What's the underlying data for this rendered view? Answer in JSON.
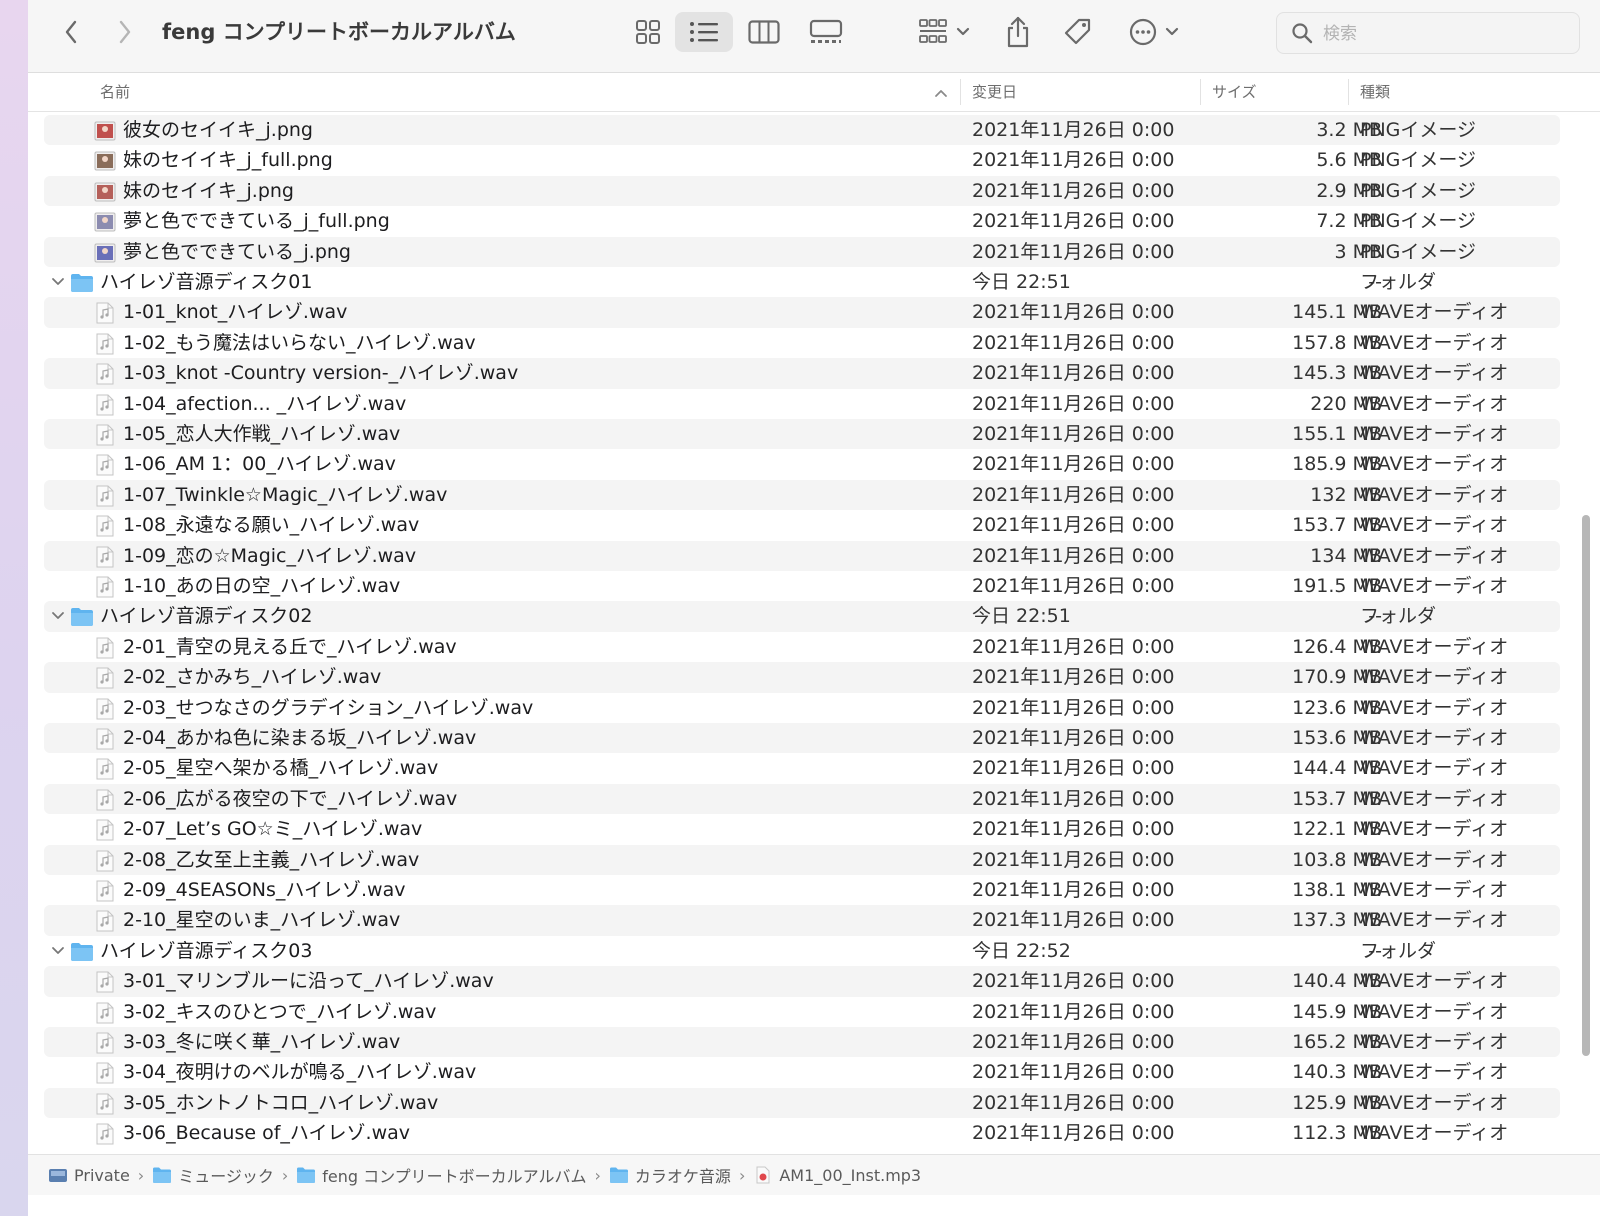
{
  "window": {
    "title": "feng コンプリートボーカルアルバム"
  },
  "toolbar": {
    "back_icon": "chevron-left-icon",
    "forward_icon": "chevron-right-icon",
    "view_modes": [
      "icon-view",
      "list-view",
      "column-view",
      "gallery-view"
    ],
    "active_view": "list-view",
    "search_placeholder": "検索"
  },
  "columns": {
    "name": "名前",
    "date": "変更日",
    "size": "サイズ",
    "kind": "種類"
  },
  "rows": [
    {
      "name": "彼女のセイイキ_j.png",
      "date": "2021年11月26日 0:00",
      "size": "3.2 MB",
      "kind": "PNGイメージ",
      "type": "image",
      "thumb": "#c0504d"
    },
    {
      "name": "妹のセイイキ_j_full.png",
      "date": "2021年11月26日 0:00",
      "size": "5.6 MB",
      "kind": "PNGイメージ",
      "type": "image",
      "thumb": "#8a6d5a"
    },
    {
      "name": "妹のセイイキ_j.png",
      "date": "2021年11月26日 0:00",
      "size": "2.9 MB",
      "kind": "PNGイメージ",
      "type": "image",
      "thumb": "#b5605a"
    },
    {
      "name": "夢と色でできている_j_full.png",
      "date": "2021年11月26日 0:00",
      "size": "7.2 MB",
      "kind": "PNGイメージ",
      "type": "image",
      "thumb": "#8c8cb0"
    },
    {
      "name": "夢と色でできている_j.png",
      "date": "2021年11月26日 0:00",
      "size": "3 MB",
      "kind": "PNGイメージ",
      "type": "image",
      "thumb": "#6a6fb8"
    },
    {
      "name": "ハイレゾ音源ディスク01",
      "date": "今日 22:51",
      "size": "--",
      "kind": "フォルダ",
      "type": "folder"
    },
    {
      "name": "1-01_knot_ハイレゾ.wav",
      "date": "2021年11月26日 0:00",
      "size": "145.1 MB",
      "kind": "WAVEオーディオ",
      "type": "audio"
    },
    {
      "name": "1-02_もう魔法はいらない_ハイレゾ.wav",
      "date": "2021年11月26日 0:00",
      "size": "157.8 MB",
      "kind": "WAVEオーディオ",
      "type": "audio"
    },
    {
      "name": "1-03_knot -Country version-_ハイレゾ.wav",
      "date": "2021年11月26日 0:00",
      "size": "145.3 MB",
      "kind": "WAVEオーディオ",
      "type": "audio"
    },
    {
      "name": "1-04_afection... _ハイレゾ.wav",
      "date": "2021年11月26日 0:00",
      "size": "220 MB",
      "kind": "WAVEオーディオ",
      "type": "audio"
    },
    {
      "name": "1-05_恋人大作戦_ハイレゾ.wav",
      "date": "2021年11月26日 0:00",
      "size": "155.1 MB",
      "kind": "WAVEオーディオ",
      "type": "audio"
    },
    {
      "name": "1-06_AM 1：00_ハイレゾ.wav",
      "date": "2021年11月26日 0:00",
      "size": "185.9 MB",
      "kind": "WAVEオーディオ",
      "type": "audio"
    },
    {
      "name": "1-07_Twinkle☆Magic_ハイレゾ.wav",
      "date": "2021年11月26日 0:00",
      "size": "132 MB",
      "kind": "WAVEオーディオ",
      "type": "audio"
    },
    {
      "name": "1-08_永遠なる願い_ハイレゾ.wav",
      "date": "2021年11月26日 0:00",
      "size": "153.7 MB",
      "kind": "WAVEオーディオ",
      "type": "audio"
    },
    {
      "name": "1-09_恋の☆Magic_ハイレゾ.wav",
      "date": "2021年11月26日 0:00",
      "size": "134 MB",
      "kind": "WAVEオーディオ",
      "type": "audio"
    },
    {
      "name": "1-10_あの日の空_ハイレゾ.wav",
      "date": "2021年11月26日 0:00",
      "size": "191.5 MB",
      "kind": "WAVEオーディオ",
      "type": "audio"
    },
    {
      "name": "ハイレゾ音源ディスク02",
      "date": "今日 22:51",
      "size": "--",
      "kind": "フォルダ",
      "type": "folder"
    },
    {
      "name": "2-01_青空の見える丘で_ハイレゾ.wav",
      "date": "2021年11月26日 0:00",
      "size": "126.4 MB",
      "kind": "WAVEオーディオ",
      "type": "audio"
    },
    {
      "name": "2-02_さかみち_ハイレゾ.wav",
      "date": "2021年11月26日 0:00",
      "size": "170.9 MB",
      "kind": "WAVEオーディオ",
      "type": "audio"
    },
    {
      "name": "2-03_せつなさのグラデイション_ハイレゾ.wav",
      "date": "2021年11月26日 0:00",
      "size": "123.6 MB",
      "kind": "WAVEオーディオ",
      "type": "audio"
    },
    {
      "name": "2-04_あかね色に染まる坂_ハイレゾ.wav",
      "date": "2021年11月26日 0:00",
      "size": "153.6 MB",
      "kind": "WAVEオーディオ",
      "type": "audio"
    },
    {
      "name": "2-05_星空へ架かる橋_ハイレゾ.wav",
      "date": "2021年11月26日 0:00",
      "size": "144.4 MB",
      "kind": "WAVEオーディオ",
      "type": "audio"
    },
    {
      "name": "2-06_広がる夜空の下で_ハイレゾ.wav",
      "date": "2021年11月26日 0:00",
      "size": "153.7 MB",
      "kind": "WAVEオーディオ",
      "type": "audio"
    },
    {
      "name": "2-07_Let’s GO☆ミ_ハイレゾ.wav",
      "date": "2021年11月26日 0:00",
      "size": "122.1 MB",
      "kind": "WAVEオーディオ",
      "type": "audio"
    },
    {
      "name": "2-08_乙女至上主義_ハイレゾ.wav",
      "date": "2021年11月26日 0:00",
      "size": "103.8 MB",
      "kind": "WAVEオーディオ",
      "type": "audio"
    },
    {
      "name": "2-09_4SEASONs_ハイレゾ.wav",
      "date": "2021年11月26日 0:00",
      "size": "138.1 MB",
      "kind": "WAVEオーディオ",
      "type": "audio"
    },
    {
      "name": "2-10_星空のいま_ハイレゾ.wav",
      "date": "2021年11月26日 0:00",
      "size": "137.3 MB",
      "kind": "WAVEオーディオ",
      "type": "audio"
    },
    {
      "name": "ハイレゾ音源ディスク03",
      "date": "今日 22:52",
      "size": "--",
      "kind": "フォルダ",
      "type": "folder"
    },
    {
      "name": "3-01_マリンブルーに沿って_ハイレゾ.wav",
      "date": "2021年11月26日 0:00",
      "size": "140.4 MB",
      "kind": "WAVEオーディオ",
      "type": "audio"
    },
    {
      "name": "3-02_キスのひとつで_ハイレゾ.wav",
      "date": "2021年11月26日 0:00",
      "size": "145.9 MB",
      "kind": "WAVEオーディオ",
      "type": "audio"
    },
    {
      "name": "3-03_冬に咲く華_ハイレゾ.wav",
      "date": "2021年11月26日 0:00",
      "size": "165.2 MB",
      "kind": "WAVEオーディオ",
      "type": "audio"
    },
    {
      "name": "3-04_夜明けのベルが鳴る_ハイレゾ.wav",
      "date": "2021年11月26日 0:00",
      "size": "140.3 MB",
      "kind": "WAVEオーディオ",
      "type": "audio"
    },
    {
      "name": "3-05_ホントノトコロ_ハイレゾ.wav",
      "date": "2021年11月26日 0:00",
      "size": "125.9 MB",
      "kind": "WAVEオーディオ",
      "type": "audio"
    },
    {
      "name": "3-06_Because of_ハイレゾ.wav",
      "date": "2021年11月26日 0:00",
      "size": "112.3 MB",
      "kind": "WAVEオーディオ",
      "type": "audio"
    }
  ],
  "scroll": {
    "thumb_start": 0.385,
    "thumb_end": 0.905
  },
  "pathbar": {
    "crumbs": [
      {
        "label": "Private",
        "icon": "drive-icon"
      },
      {
        "label": "ミュージック",
        "icon": "folder-icon"
      },
      {
        "label": "feng コンプリートボーカルアルバム",
        "icon": "folder-icon"
      },
      {
        "label": "カラオケ音源",
        "icon": "folder-icon"
      },
      {
        "label": "AM1_00_Inst.mp3",
        "icon": "audio-file-icon"
      }
    ]
  },
  "colors": {
    "folder_blue": "#5fb4ef",
    "accent": "#007aff"
  }
}
